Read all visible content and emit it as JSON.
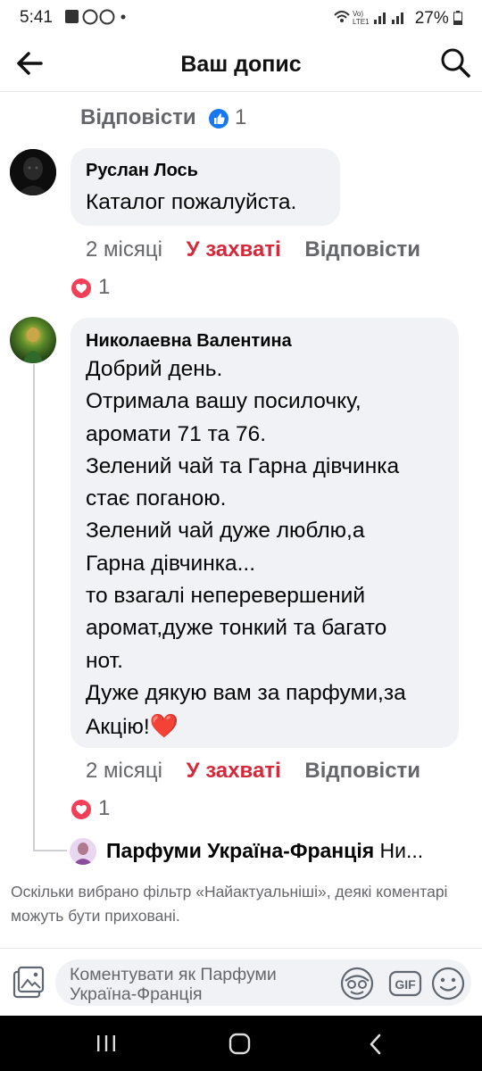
{
  "status_bar": {
    "time": "5:41",
    "notif_icons": "image-icon whatsapp-icon viber-icon dot",
    "net": "Vo) LTE1",
    "battery": "27%"
  },
  "header": {
    "title": "Ваш допис"
  },
  "previous_comment": {
    "reply_label": "Відповісти",
    "like_count": "1"
  },
  "comments": [
    {
      "author": "Руслан Лось",
      "text": "Каталог пожалуйста.",
      "time": "2 місяці",
      "reaction_label": "У захваті",
      "reply_label": "Відповісти",
      "reaction_count": "1"
    },
    {
      "author": "Николаевна Валентина",
      "lines": [
        "Добрий день.",
        "Отримала вашу посилочку,",
        "аромати 71 та 76.",
        "Зелений чай та Гарна дівчинка",
        "стає поганою.",
        "Зелений чай дуже люблю,а",
        "Гарна дівчинка...",
        "то взагалі неперевершений",
        "аромат,дуже тонкий та багато",
        "нот.",
        "Дуже дякую вам за парфуми,за",
        "Акцію!"
      ],
      "emoji": "❤️",
      "time": "2 місяці",
      "reaction_label": "У захваті",
      "reply_label": "Відповісти",
      "reaction_count": "1"
    }
  ],
  "reply_preview": {
    "author": "Парфуми Україна-Франція",
    "snippet": "Ни..."
  },
  "filter_notice": "Оскільки вибрано фільтр «Найактуальніші», деякі коментарі можуть бути приховані.",
  "composer": {
    "placeholder": "Коментувати як Парфуми Україна-Франція",
    "gif_label": "GIF"
  },
  "colors": {
    "accent_blue": "#1877f2",
    "love_red": "#d6283b",
    "heart_badge": "#f33e58",
    "bubble_bg": "#f0f2f5",
    "muted_text": "#65676b"
  },
  "icons": [
    "back-arrow-icon",
    "search-icon",
    "like-icon",
    "heart-icon",
    "photo-icon",
    "avatar-sticker-icon",
    "gif-icon",
    "emoji-icon",
    "recents-icon",
    "home-icon",
    "back-nav-icon"
  ]
}
